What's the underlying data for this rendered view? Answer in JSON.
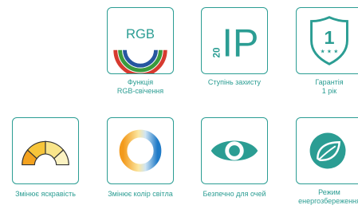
{
  "colors": {
    "teal": "#2b9d93",
    "red": "#d63a2f",
    "green": "#3a9a3e",
    "blue": "#2656a0"
  },
  "features": [
    {
      "icon": "rgb-rainbow-icon",
      "badge": "RGB",
      "caption_lines": [
        "Функція",
        "RGB-свічення"
      ]
    },
    {
      "icon": "ip20-icon",
      "badge_main": "IP",
      "badge_small": "20",
      "caption_lines": [
        "Ступінь захисту"
      ]
    },
    {
      "icon": "warranty-shield-icon",
      "badge": "1",
      "caption_lines": [
        "Гарантія",
        "1 рік"
      ]
    },
    {
      "icon": "brightness-gauge-icon",
      "caption_lines": [
        "Змінює яскравість"
      ]
    },
    {
      "icon": "color-temperature-ring-icon",
      "caption_lines": [
        "Змінює колір світла"
      ]
    },
    {
      "icon": "eye-icon",
      "caption_lines": [
        "Безпечно для очей"
      ]
    },
    {
      "icon": "leaf-energy-icon",
      "caption_lines": [
        "Режим",
        "енергозбереження"
      ]
    }
  ]
}
